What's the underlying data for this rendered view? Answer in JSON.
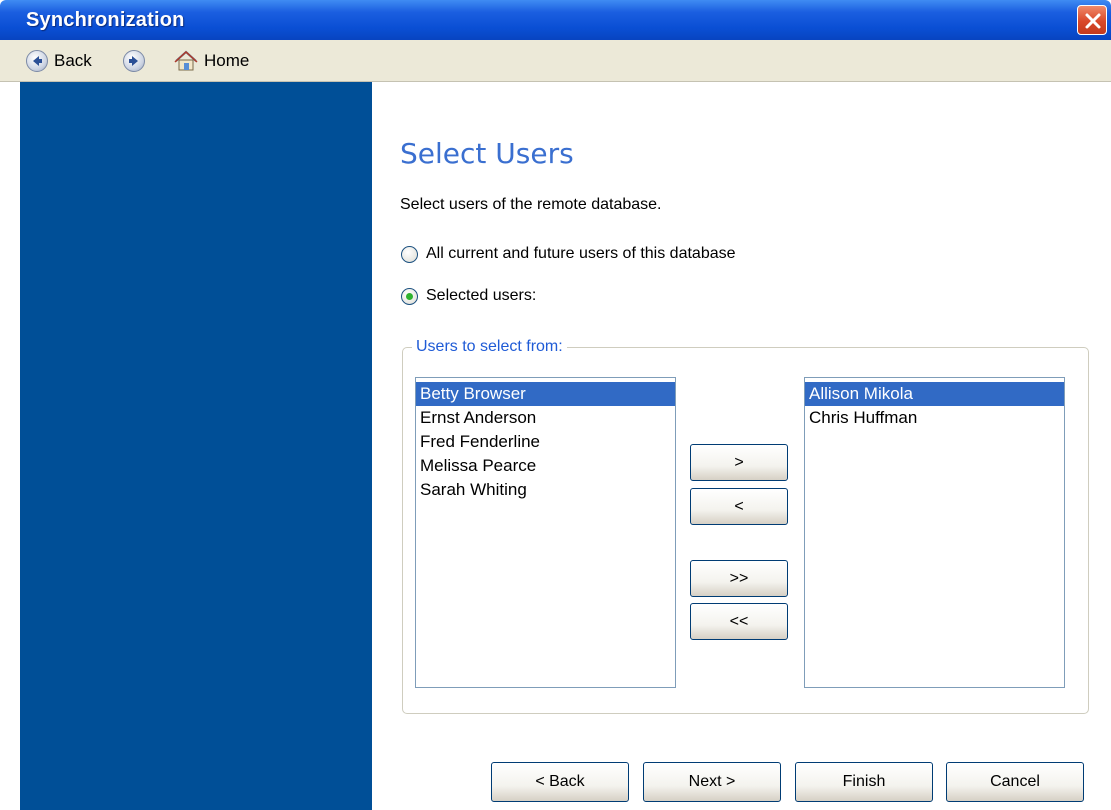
{
  "window": {
    "title": "Synchronization"
  },
  "toolbar": {
    "back_label": "Back",
    "home_label": "Home"
  },
  "page": {
    "heading": "Select Users",
    "description": "Select users of the remote database.",
    "option_all": "All current and future users of this database",
    "option_selected": "Selected users:",
    "selected_option": "option_selected"
  },
  "group": {
    "label": "Users to select from:"
  },
  "available_users": [
    "Betty Browser",
    "Ernst Anderson",
    "Fred Fenderline",
    "Melissa Pearce",
    "Sarah Whiting"
  ],
  "selected_users": [
    "Allison Mikola",
    "Chris Huffman"
  ],
  "transfer": {
    "add": ">",
    "remove": "<",
    "add_all": ">>",
    "remove_all": "<<"
  },
  "footer": {
    "back": "< Back",
    "next": "Next >",
    "finish": "Finish",
    "cancel": "Cancel"
  },
  "colors": {
    "accent": "#316ac5",
    "sidebar": "#004f97",
    "title_bar": "#0a4fd4",
    "heading": "#3a6fd0"
  },
  "icons": {
    "close": "close-icon",
    "back": "back-arrow-icon",
    "forward": "forward-arrow-icon",
    "home": "home-icon"
  }
}
